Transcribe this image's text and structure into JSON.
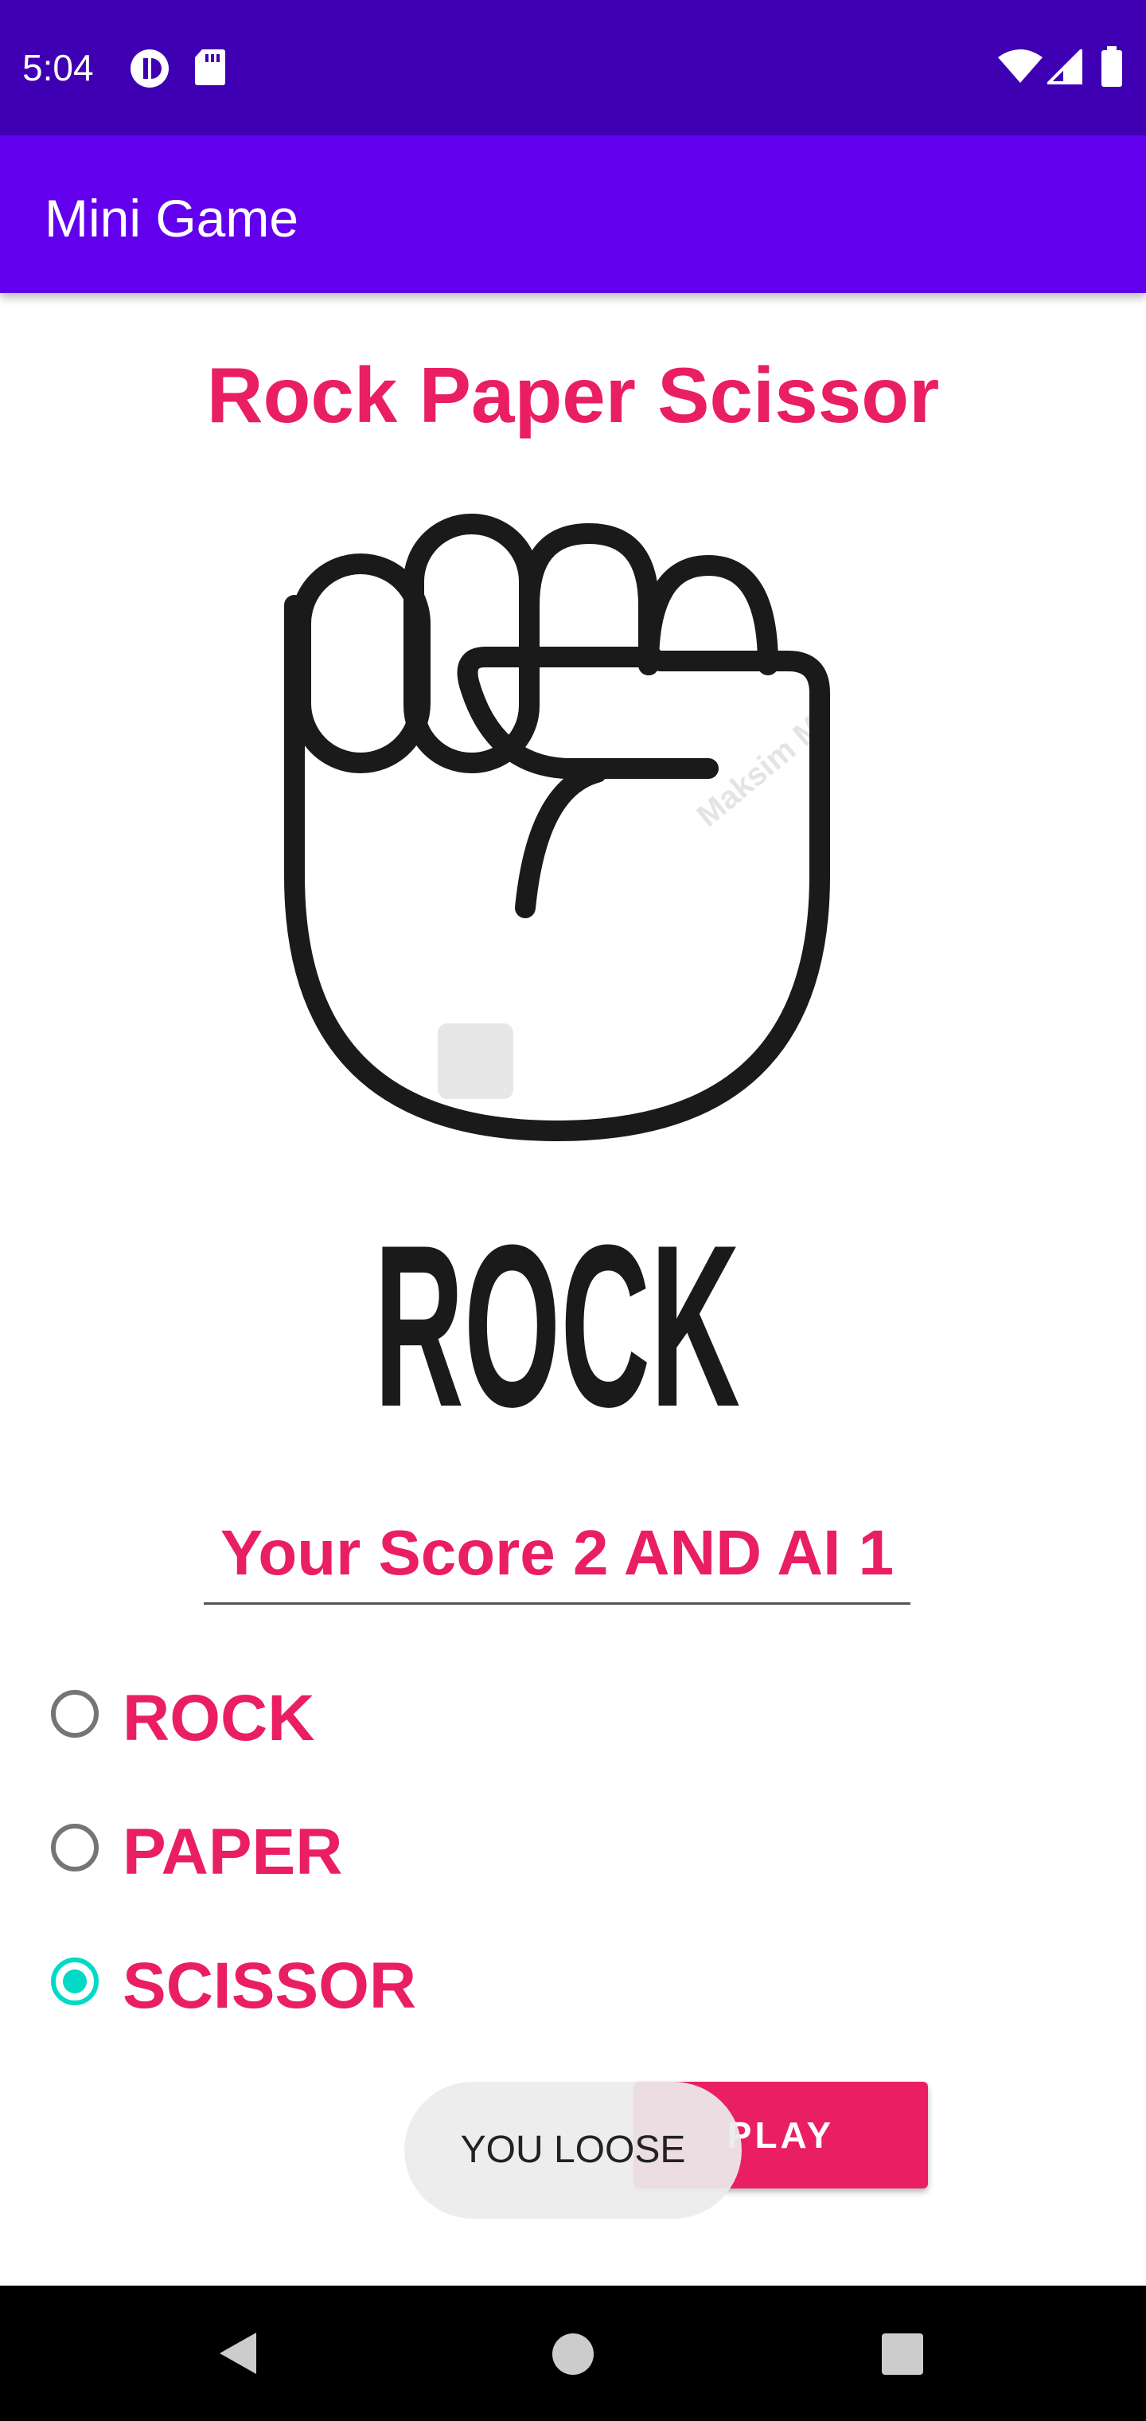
{
  "status_bar": {
    "time": "5:04",
    "left_icons": [
      "data-saver-icon",
      "sd-card-icon"
    ],
    "right_icons": [
      "wifi-icon",
      "signal-icon",
      "battery-icon"
    ]
  },
  "app_bar": {
    "title": "Mini Game"
  },
  "main": {
    "heading": "Rock Paper Scissor",
    "hero_image": {
      "caption": "ROCK",
      "watermark": "Maksim M",
      "icon": "rock-fist-icon"
    },
    "score_text": "Your Score 2 AND AI 1",
    "options": [
      {
        "label": "ROCK",
        "checked": false
      },
      {
        "label": "PAPER",
        "checked": false
      },
      {
        "label": "SCISSOR",
        "checked": true
      }
    ],
    "play_label": "PLAY"
  },
  "toast": {
    "message": "YOU LOOSE"
  },
  "nav_bar": {
    "icons": [
      "back-icon",
      "home-icon",
      "recents-icon"
    ]
  },
  "colors": {
    "status_bar": "#3f00b4",
    "app_bar": "#6200ee",
    "accent": "#e91e63",
    "radio_checked": "#03dac5"
  }
}
